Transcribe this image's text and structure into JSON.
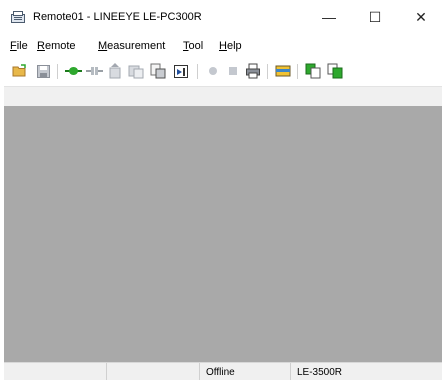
{
  "window": {
    "title": "Remote01 - LINEEYE LE-PC300R",
    "minimize_glyph": "—",
    "maximize_glyph": "☐",
    "close_glyph": "✕"
  },
  "menu": [
    {
      "mnemonic": "F",
      "rest": "ile"
    },
    {
      "mnemonic": "R",
      "rest": "emote"
    },
    {
      "mnemonic": "M",
      "rest": "easurement"
    },
    {
      "mnemonic": "T",
      "rest": "ool"
    },
    {
      "mnemonic": "H",
      "rest": "elp"
    }
  ],
  "toolbar": {
    "icons": [
      "open-folder-icon",
      "save-icon",
      "connect-icon",
      "disconnect-icon",
      "upload-icon",
      "download-icon",
      "transfer-icon",
      "display-icon",
      "record-icon",
      "stop-icon",
      "print-icon",
      "monitor-icon",
      "copy-icon",
      "paste-icon"
    ]
  },
  "status": {
    "connection": "Offline",
    "model": "LE-3500R"
  },
  "colors": {
    "workspace": "#a9a9a9",
    "green": "#2ea82e",
    "folder": "#e8b84a"
  }
}
